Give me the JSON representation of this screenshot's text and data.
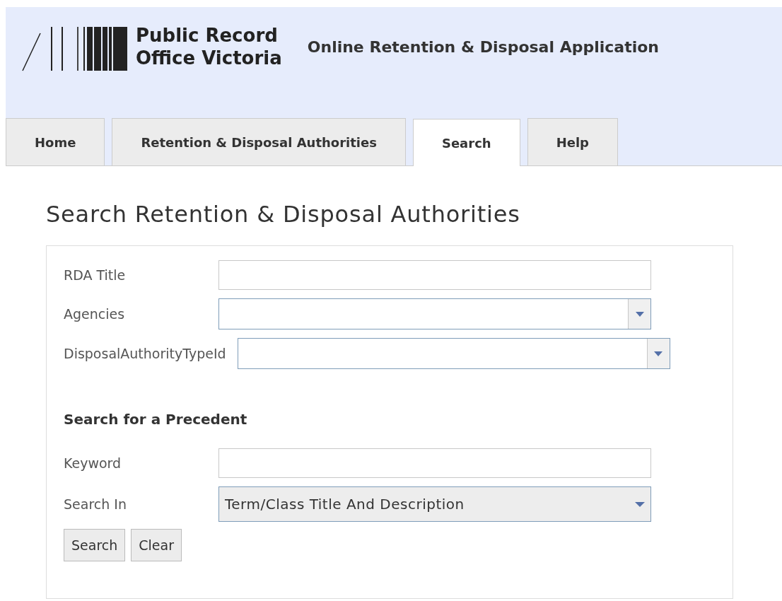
{
  "header": {
    "logo_text": [
      "Public Record",
      "Office Victoria"
    ],
    "app_title": "Online Retention & Disposal Application"
  },
  "tabs": [
    {
      "label": "Home",
      "selected": false
    },
    {
      "label": "Retention & Disposal Authorities",
      "selected": false
    },
    {
      "label": "Search",
      "selected": true
    },
    {
      "label": "Help",
      "selected": false
    }
  ],
  "page_title": "Search Retention & Disposal Authorities",
  "fields": [
    {
      "kind": "text",
      "label": "RDA Title"
    },
    {
      "kind": "combo",
      "label": "Agencies"
    },
    {
      "kind": "combo",
      "label": "DisposalAuthorityTypeId"
    }
  ],
  "precedent": {
    "heading": "Search for a Precedent",
    "fields": [
      {
        "kind": "text",
        "label": "Keyword"
      },
      {
        "kind": "select",
        "label": "Search In",
        "value": "Term/Class Title And Description"
      }
    ]
  },
  "buttons": [
    "Search",
    "Clear"
  ]
}
